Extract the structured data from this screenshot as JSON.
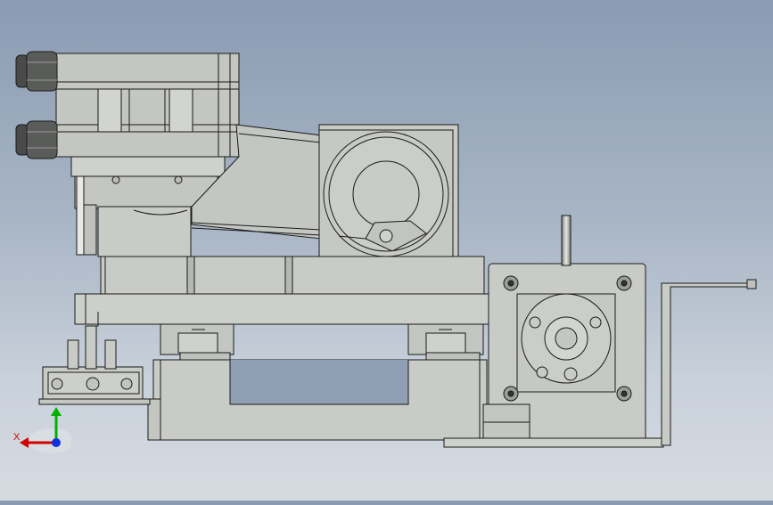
{
  "viewport": {
    "background_top": "#8a9bb2",
    "background_bottom": "#d6dbe1",
    "part_fill": "#c9ccc6",
    "part_fill_dark": "#b9bcb6",
    "edge_color": "#1a1a1a"
  },
  "triad": {
    "x_label": "X",
    "x_color": "#d40000",
    "y_color": "#00b000",
    "z_color": "#1030e0"
  }
}
